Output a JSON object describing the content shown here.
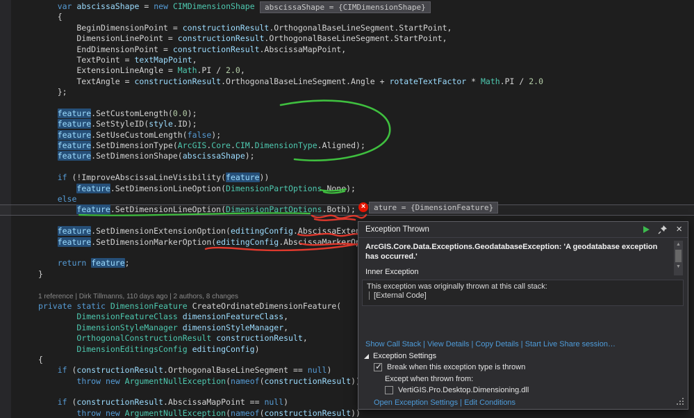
{
  "colors": {
    "keyword": "#569cd6",
    "type": "#4ec9b0",
    "identifier": "#9cdcfe",
    "number": "#b5cea8",
    "plain": "#d4d4d4",
    "reference_highlight_bg": "#264f78",
    "link": "#4e9cda",
    "annotation_green": "#3fbf3f",
    "annotation_red": "#e0392d",
    "exception_badge_red": "#e51400",
    "continue_green": "#3dba4e"
  },
  "datatips": {
    "abscissa": "abscissaShape = {CIMDimensionShape}",
    "feature": "ature = {DimensionFeature}"
  },
  "exception_marker_glyph": "×",
  "code": {
    "current_line_index": 19,
    "lines": [
      {
        "segs": [
          {
            "c": "pl",
            "t": "    "
          },
          {
            "c": "kw",
            "t": "var"
          },
          {
            "c": "pl",
            "t": " "
          },
          {
            "c": "id",
            "t": "abscissaShape"
          },
          {
            "c": "pl",
            "t": " = "
          },
          {
            "c": "kw",
            "t": "new"
          },
          {
            "c": "pl",
            "t": " "
          },
          {
            "c": "tp",
            "t": "CIMDimensionShape"
          }
        ]
      },
      {
        "segs": [
          {
            "c": "pl",
            "t": "    {"
          }
        ]
      },
      {
        "segs": [
          {
            "c": "pl",
            "t": "        BeginDimensionPoint = "
          },
          {
            "c": "id",
            "t": "constructionResult"
          },
          {
            "c": "pl",
            "t": ".OrthogonalBaseLineSegment.StartPoint,"
          }
        ]
      },
      {
        "segs": [
          {
            "c": "pl",
            "t": "        DimensionLinePoint = "
          },
          {
            "c": "id",
            "t": "constructionResult"
          },
          {
            "c": "pl",
            "t": ".OrthogonalBaseLineSegment.StartPoint,"
          }
        ]
      },
      {
        "segs": [
          {
            "c": "pl",
            "t": "        EndDimensionPoint = "
          },
          {
            "c": "id",
            "t": "constructionResult"
          },
          {
            "c": "pl",
            "t": ".AbscissaMapPoint,"
          }
        ]
      },
      {
        "segs": [
          {
            "c": "pl",
            "t": "        TextPoint = "
          },
          {
            "c": "id",
            "t": "textMapPoint"
          },
          {
            "c": "pl",
            "t": ","
          }
        ]
      },
      {
        "segs": [
          {
            "c": "pl",
            "t": "        ExtensionLineAngle = "
          },
          {
            "c": "tp",
            "t": "Math"
          },
          {
            "c": "pl",
            "t": ".PI / "
          },
          {
            "c": "nm",
            "t": "2.0"
          },
          {
            "c": "pl",
            "t": ","
          }
        ]
      },
      {
        "segs": [
          {
            "c": "pl",
            "t": "        TextAngle = "
          },
          {
            "c": "id",
            "t": "constructionResult"
          },
          {
            "c": "pl",
            "t": ".OrthogonalBaseLineSegment.Angle + "
          },
          {
            "c": "id",
            "t": "rotateTextFactor"
          },
          {
            "c": "pl",
            "t": " * "
          },
          {
            "c": "tp",
            "t": "Math"
          },
          {
            "c": "pl",
            "t": ".PI / "
          },
          {
            "c": "nm",
            "t": "2.0"
          }
        ]
      },
      {
        "segs": [
          {
            "c": "pl",
            "t": "    };"
          }
        ]
      },
      {
        "segs": []
      },
      {
        "segs": [
          {
            "c": "pl",
            "t": "    "
          },
          {
            "c": "hl",
            "t": "feature"
          },
          {
            "c": "pl",
            "t": ".SetCustomLength("
          },
          {
            "c": "nm",
            "t": "0.0"
          },
          {
            "c": "pl",
            "t": ");"
          }
        ]
      },
      {
        "segs": [
          {
            "c": "pl",
            "t": "    "
          },
          {
            "c": "hl",
            "t": "feature"
          },
          {
            "c": "pl",
            "t": ".SetStyleID("
          },
          {
            "c": "id",
            "t": "style"
          },
          {
            "c": "pl",
            "t": ".ID);"
          }
        ]
      },
      {
        "segs": [
          {
            "c": "pl",
            "t": "    "
          },
          {
            "c": "hl",
            "t": "feature"
          },
          {
            "c": "pl",
            "t": ".SetUseCustomLength("
          },
          {
            "c": "kw",
            "t": "false"
          },
          {
            "c": "pl",
            "t": ");"
          }
        ]
      },
      {
        "segs": [
          {
            "c": "pl",
            "t": "    "
          },
          {
            "c": "hl",
            "t": "feature"
          },
          {
            "c": "pl",
            "t": ".SetDimensionType("
          },
          {
            "c": "tp",
            "t": "ArcGIS"
          },
          {
            "c": "pl",
            "t": "."
          },
          {
            "c": "tp",
            "t": "Core"
          },
          {
            "c": "pl",
            "t": "."
          },
          {
            "c": "tp",
            "t": "CIM"
          },
          {
            "c": "pl",
            "t": "."
          },
          {
            "c": "tp",
            "t": "DimensionType"
          },
          {
            "c": "pl",
            "t": ".Aligned);"
          }
        ]
      },
      {
        "segs": [
          {
            "c": "pl",
            "t": "    "
          },
          {
            "c": "hl",
            "t": "feature"
          },
          {
            "c": "pl",
            "t": ".SetDimensionShape("
          },
          {
            "c": "id",
            "t": "abscissaShape"
          },
          {
            "c": "pl",
            "t": ");"
          }
        ]
      },
      {
        "segs": []
      },
      {
        "segs": [
          {
            "c": "pl",
            "t": "    "
          },
          {
            "c": "kw",
            "t": "if"
          },
          {
            "c": "pl",
            "t": " (!ImproveAbscissaLineVisibility("
          },
          {
            "c": "hl",
            "t": "feature"
          },
          {
            "c": "pl",
            "t": "))"
          }
        ]
      },
      {
        "segs": [
          {
            "c": "pl",
            "t": "        "
          },
          {
            "c": "hl",
            "t": "feature"
          },
          {
            "c": "pl",
            "t": ".SetDimensionLineOption("
          },
          {
            "c": "tp",
            "t": "DimensionPartOptions"
          },
          {
            "c": "pl",
            "t": ".None);"
          }
        ]
      },
      {
        "segs": [
          {
            "c": "pl",
            "t": "    "
          },
          {
            "c": "kw",
            "t": "else"
          }
        ]
      },
      {
        "segs": [
          {
            "c": "pl",
            "t": "        "
          },
          {
            "c": "hl",
            "t": "feature"
          },
          {
            "c": "pl",
            "t": ".SetDimensionLineOption("
          },
          {
            "c": "tp",
            "t": "DimensionPartOptions"
          },
          {
            "c": "pl",
            "t": ".Both);"
          }
        ]
      },
      {
        "segs": []
      },
      {
        "segs": [
          {
            "c": "pl",
            "t": "    "
          },
          {
            "c": "hl",
            "t": "feature"
          },
          {
            "c": "pl",
            "t": ".SetDimensionExtensionOption("
          },
          {
            "c": "id",
            "t": "editingConfig"
          },
          {
            "c": "pl",
            "t": ".AbscissaExten"
          }
        ]
      },
      {
        "segs": [
          {
            "c": "pl",
            "t": "    "
          },
          {
            "c": "hl",
            "t": "feature"
          },
          {
            "c": "pl",
            "t": ".SetDimensionMarkerOption("
          },
          {
            "c": "id",
            "t": "editingConfig"
          },
          {
            "c": "pl",
            "t": ".AbscissaMarkerOp"
          }
        ]
      },
      {
        "segs": []
      },
      {
        "segs": [
          {
            "c": "pl",
            "t": "    "
          },
          {
            "c": "kw",
            "t": "return"
          },
          {
            "c": "pl",
            "t": " "
          },
          {
            "c": "hl",
            "t": "feature"
          },
          {
            "c": "pl",
            "t": ";"
          }
        ]
      },
      {
        "segs": [
          {
            "c": "pl",
            "t": "}"
          }
        ]
      },
      {
        "segs": []
      },
      {
        "lens": "1 reference | Dirk Tillmanns, 110 days ago | 2 authors, 8 changes"
      },
      {
        "segs": [
          {
            "c": "kw",
            "t": "private"
          },
          {
            "c": "pl",
            "t": " "
          },
          {
            "c": "kw",
            "t": "static"
          },
          {
            "c": "pl",
            "t": " "
          },
          {
            "c": "tp",
            "t": "DimensionFeature"
          },
          {
            "c": "pl",
            "t": " CreateOrdinateDimensionFeature("
          }
        ]
      },
      {
        "segs": [
          {
            "c": "pl",
            "t": "        "
          },
          {
            "c": "tp",
            "t": "DimensionFeatureClass"
          },
          {
            "c": "pl",
            "t": " "
          },
          {
            "c": "id",
            "t": "dimensionFeatureClass"
          },
          {
            "c": "pl",
            "t": ","
          }
        ]
      },
      {
        "segs": [
          {
            "c": "pl",
            "t": "        "
          },
          {
            "c": "tp",
            "t": "DimensionStyleManager"
          },
          {
            "c": "pl",
            "t": " "
          },
          {
            "c": "id",
            "t": "dimensionStyleManager"
          },
          {
            "c": "pl",
            "t": ","
          }
        ]
      },
      {
        "segs": [
          {
            "c": "pl",
            "t": "        "
          },
          {
            "c": "tp",
            "t": "OrthogonalConstructionResult"
          },
          {
            "c": "pl",
            "t": " "
          },
          {
            "c": "id",
            "t": "constructionResult"
          },
          {
            "c": "pl",
            "t": ","
          }
        ]
      },
      {
        "segs": [
          {
            "c": "pl",
            "t": "        "
          },
          {
            "c": "tp",
            "t": "DimensionEditingsConfig"
          },
          {
            "c": "pl",
            "t": " "
          },
          {
            "c": "id",
            "t": "editingConfig"
          },
          {
            "c": "pl",
            "t": ")"
          }
        ]
      },
      {
        "segs": [
          {
            "c": "pl",
            "t": "{"
          }
        ]
      },
      {
        "segs": [
          {
            "c": "pl",
            "t": "    "
          },
          {
            "c": "kw",
            "t": "if"
          },
          {
            "c": "pl",
            "t": " ("
          },
          {
            "c": "id",
            "t": "constructionResult"
          },
          {
            "c": "pl",
            "t": ".OrthogonalBaseLineSegment == "
          },
          {
            "c": "kw",
            "t": "null"
          },
          {
            "c": "pl",
            "t": ")"
          }
        ]
      },
      {
        "segs": [
          {
            "c": "pl",
            "t": "        "
          },
          {
            "c": "kw",
            "t": "throw"
          },
          {
            "c": "pl",
            "t": " "
          },
          {
            "c": "kw",
            "t": "new"
          },
          {
            "c": "pl",
            "t": " "
          },
          {
            "c": "tp",
            "t": "ArgumentNullException"
          },
          {
            "c": "pl",
            "t": "("
          },
          {
            "c": "kw",
            "t": "nameof"
          },
          {
            "c": "pl",
            "t": "("
          },
          {
            "c": "id",
            "t": "constructionResult"
          },
          {
            "c": "pl",
            "t": "))"
          }
        ]
      },
      {
        "segs": []
      },
      {
        "segs": [
          {
            "c": "pl",
            "t": "    "
          },
          {
            "c": "kw",
            "t": "if"
          },
          {
            "c": "pl",
            "t": " ("
          },
          {
            "c": "id",
            "t": "constructionResult"
          },
          {
            "c": "pl",
            "t": ".AbscissaMapPoint == "
          },
          {
            "c": "kw",
            "t": "null"
          },
          {
            "c": "pl",
            "t": ")"
          }
        ]
      },
      {
        "segs": [
          {
            "c": "pl",
            "t": "        "
          },
          {
            "c": "kw",
            "t": "throw"
          },
          {
            "c": "pl",
            "t": " "
          },
          {
            "c": "kw",
            "t": "new"
          },
          {
            "c": "pl",
            "t": " "
          },
          {
            "c": "tp",
            "t": "ArgumentNullException"
          },
          {
            "c": "pl",
            "t": "("
          },
          {
            "c": "kw",
            "t": "nameof"
          },
          {
            "c": "pl",
            "t": "("
          },
          {
            "c": "id",
            "t": "constructionResult"
          },
          {
            "c": "pl",
            "t": "))"
          }
        ]
      }
    ]
  },
  "exception_dialog": {
    "title": "Exception Thrown",
    "message": "ArcGIS.Core.Data.Exceptions.GeodatabaseException: 'A geodatabase exception has occurred.'",
    "inner_exception_label": "Inner Exception",
    "callstack_intro": "This exception was originally thrown at this call stack:",
    "callstack_items": [
      "[External Code]"
    ],
    "links": [
      "Show Call Stack",
      "View Details",
      "Copy Details",
      "Start Live Share session…"
    ],
    "settings": {
      "header": "Exception Settings",
      "break_checkbox": {
        "label": "Break when this exception type is thrown",
        "checked": true
      },
      "except_label": "Except when thrown from:",
      "module_checkbox": {
        "label": "VertiGIS.Pro.Desktop.Dimensioning.dll",
        "checked": false
      },
      "links": [
        "Open Exception Settings",
        "Edit Conditions"
      ]
    },
    "scrollbar": {
      "up_glyph": "▲",
      "down_glyph": "▼"
    }
  }
}
